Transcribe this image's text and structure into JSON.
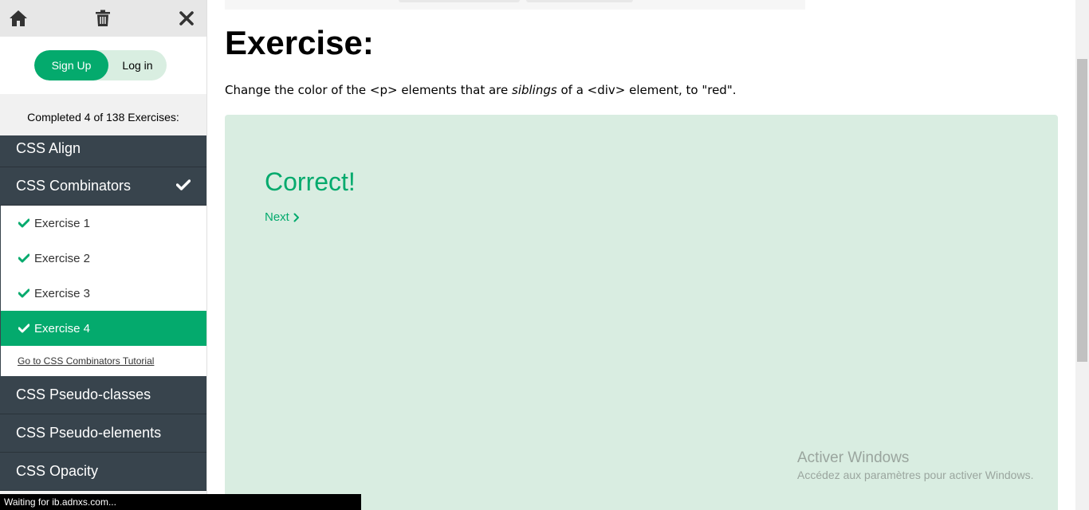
{
  "sidebar": {
    "icons": {
      "home": "home-icon",
      "trash": "trash-icon",
      "close": "close-icon"
    },
    "auth": {
      "signup_label": "Sign Up",
      "login_label": "Log in"
    },
    "progress_text": "Completed 4 of 138 Exercises:",
    "categories_before": [
      {
        "label": "CSS Align"
      }
    ],
    "active_category": {
      "label": "CSS Combinators"
    },
    "exercises": [
      {
        "label": "Exercise 1"
      },
      {
        "label": "Exercise 2"
      },
      {
        "label": "Exercise 3"
      },
      {
        "label": "Exercise 4"
      }
    ],
    "tutorial_link": "Go to CSS Combinators Tutorial",
    "categories_after": [
      {
        "label": "CSS Pseudo-classes"
      },
      {
        "label": "CSS Pseudo-elements"
      },
      {
        "label": "CSS Opacity"
      }
    ]
  },
  "main": {
    "title": "Exercise:",
    "description": {
      "before": "Change the color of the <p> elements that are ",
      "emphasis": "siblings",
      "after": " of a <div> element, to \"red\"."
    },
    "result": {
      "message": "Correct!",
      "next_label": "Next"
    }
  },
  "watermark": {
    "title": "Activer Windows",
    "subtitle": "Accédez aux paramètres pour activer Windows."
  },
  "statusbar": {
    "text": "Waiting for ib.adnxs.com..."
  },
  "colors": {
    "accent": "#04aa6d",
    "sidebar_dark": "#38444d",
    "result_bg": "#d9ede1"
  }
}
